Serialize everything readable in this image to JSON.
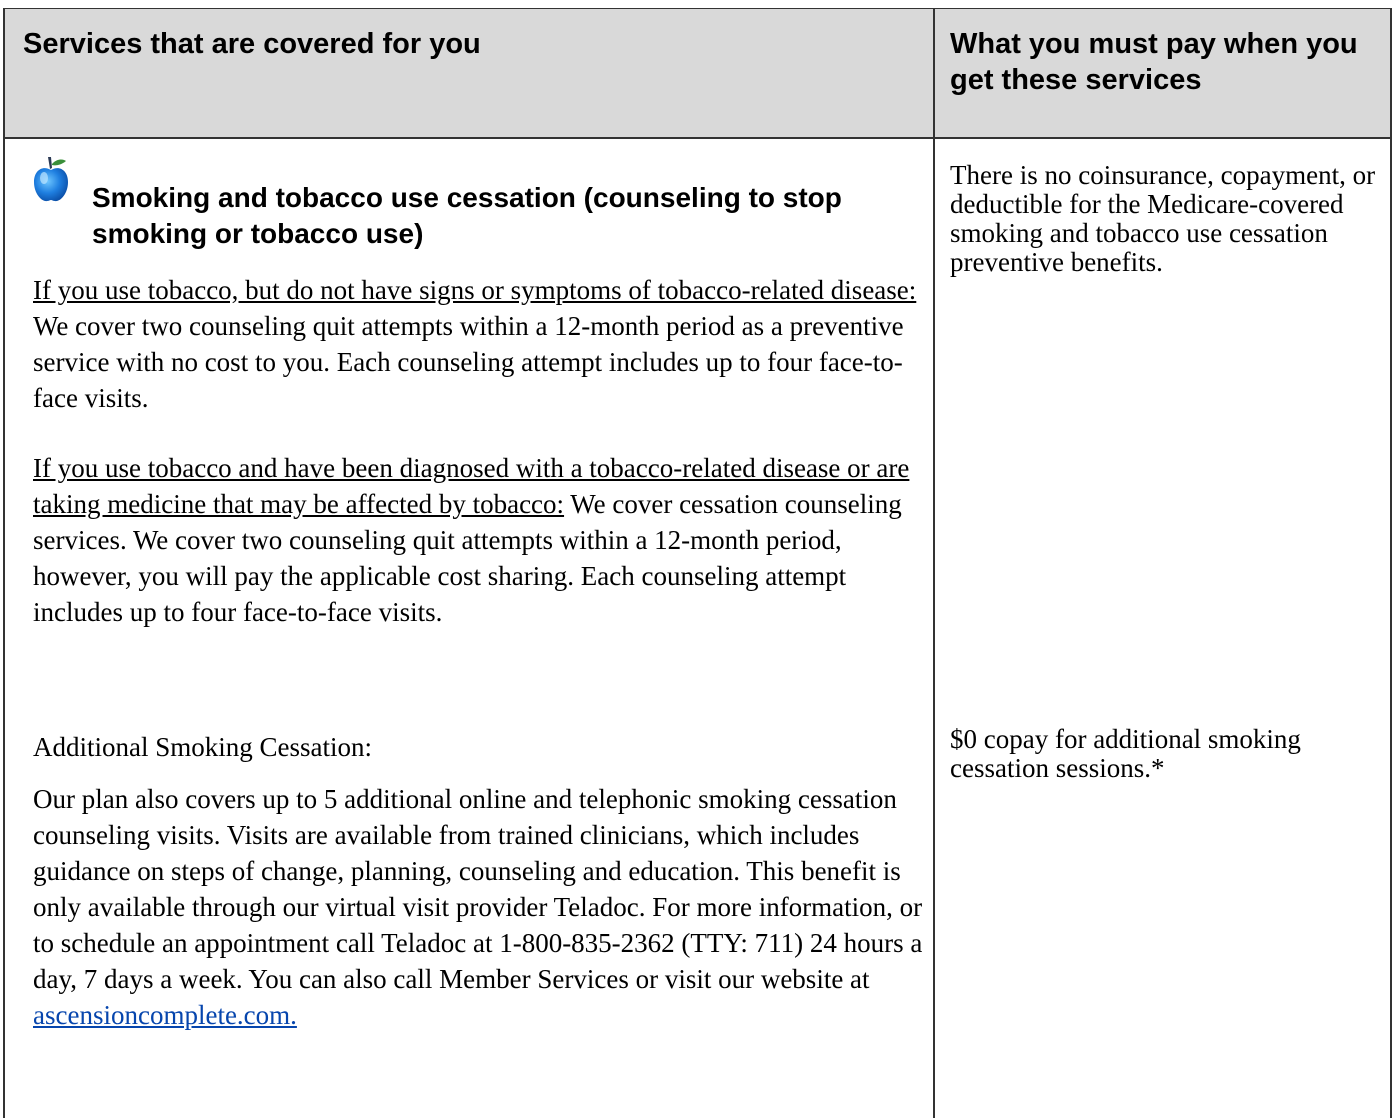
{
  "header": {
    "col_services": "Services that are covered for you",
    "col_pay": "What you must pay when you get these services"
  },
  "section": {
    "icon": "apple-icon",
    "title": "Smoking and tobacco use cessation (counseling to stop smoking or tobacco use)",
    "para1_underlined": "If you use tobacco, but do not have signs or symptoms of tobacco-related disease:",
    "para1_rest": " We cover two counseling quit attempts within a 12-month period as a preventive service with no cost to you. Each counseling attempt includes up to four face-to-face visits.",
    "para2_underlined": "If you use tobacco and have been diagnosed with a tobacco-related disease or are taking medicine that may be affected by tobacco:",
    "para2_rest": " We cover cessation counseling services. We cover two counseling quit attempts within a 12-month period, however, you will pay the applicable cost sharing. Each counseling attempt includes up to four face-to-face visits.",
    "additional_heading": "Additional Smoking Cessation:",
    "additional_body": "Our plan also covers up to 5 additional online and telephonic smoking cessation counseling visits. Visits are available from trained clinicians, which includes guidance on steps of change, planning, counseling and education. This benefit is only available through our virtual visit provider Teladoc. For more information, or to schedule an appointment call Teladoc at 1-800-835-2362 (TTY: 711) 24 hours a day, 7 days a week. You can also call Member Services or visit our website at ",
    "website_link": "ascensioncomplete.com. "
  },
  "costs": {
    "preventive": "There is no coinsurance, copayment, or deductible for the Medicare-covered smoking and tobacco use cessation preventive benefits.",
    "additional": "$0 copay for additional smoking cessation sessions.*"
  }
}
